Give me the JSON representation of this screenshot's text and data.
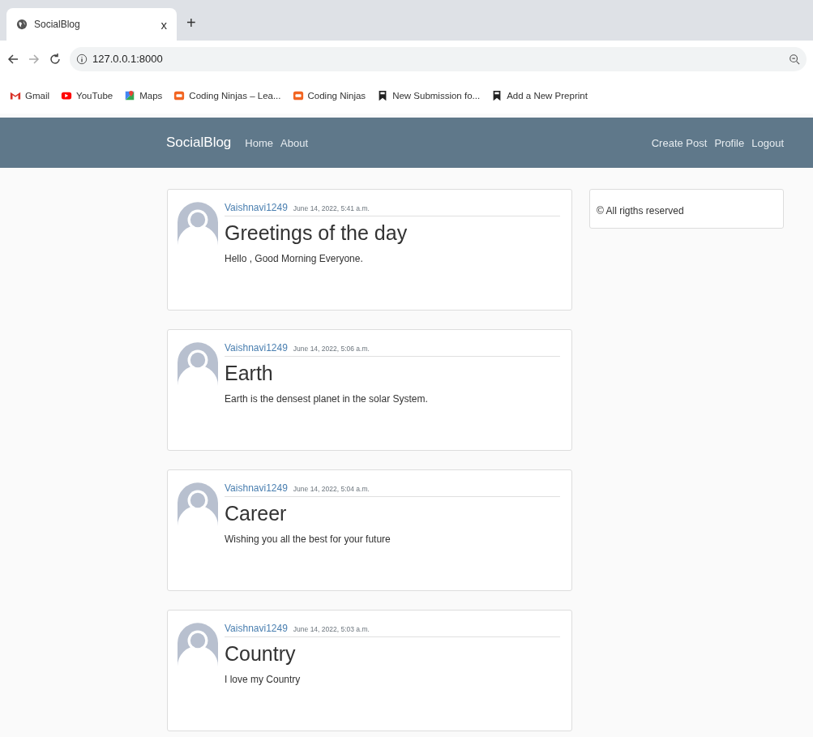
{
  "browser": {
    "tab": {
      "title": "SocialBlog",
      "close": "x"
    },
    "new_tab": "+",
    "url": "127.0.0.1:8000",
    "bookmarks": [
      {
        "kind": "gmail",
        "label": "Gmail"
      },
      {
        "kind": "youtube",
        "label": "YouTube"
      },
      {
        "kind": "maps",
        "label": "Maps"
      },
      {
        "kind": "ninjas",
        "label": "Coding Ninjas – Lea..."
      },
      {
        "kind": "ninjas",
        "label": "Coding Ninjas"
      },
      {
        "kind": "bookmark",
        "label": "New Submission fo..."
      },
      {
        "kind": "bookmark",
        "label": "Add a New Preprint"
      }
    ]
  },
  "navbar": {
    "brand": "SocialBlog",
    "left_links": [
      "Home",
      "About"
    ],
    "right_links": [
      "Create Post",
      "Profile",
      "Logout"
    ]
  },
  "posts": [
    {
      "author": "Vaishnavi1249",
      "date": "June 14, 2022, 5:41 a.m.",
      "title": "Greetings of the day",
      "content": "Hello , Good Morning Everyone."
    },
    {
      "author": "Vaishnavi1249",
      "date": "June 14, 2022, 5:06 a.m.",
      "title": "Earth",
      "content": "Earth is the densest planet in the solar System."
    },
    {
      "author": "Vaishnavi1249",
      "date": "June 14, 2022, 5:04 a.m.",
      "title": "Career",
      "content": "Wishing you all the best for your future"
    },
    {
      "author": "Vaishnavi1249",
      "date": "June 14, 2022, 5:03 a.m.",
      "title": "Country",
      "content": "I love my Country"
    }
  ],
  "sidebar": {
    "text": "© All rigths reserved"
  }
}
